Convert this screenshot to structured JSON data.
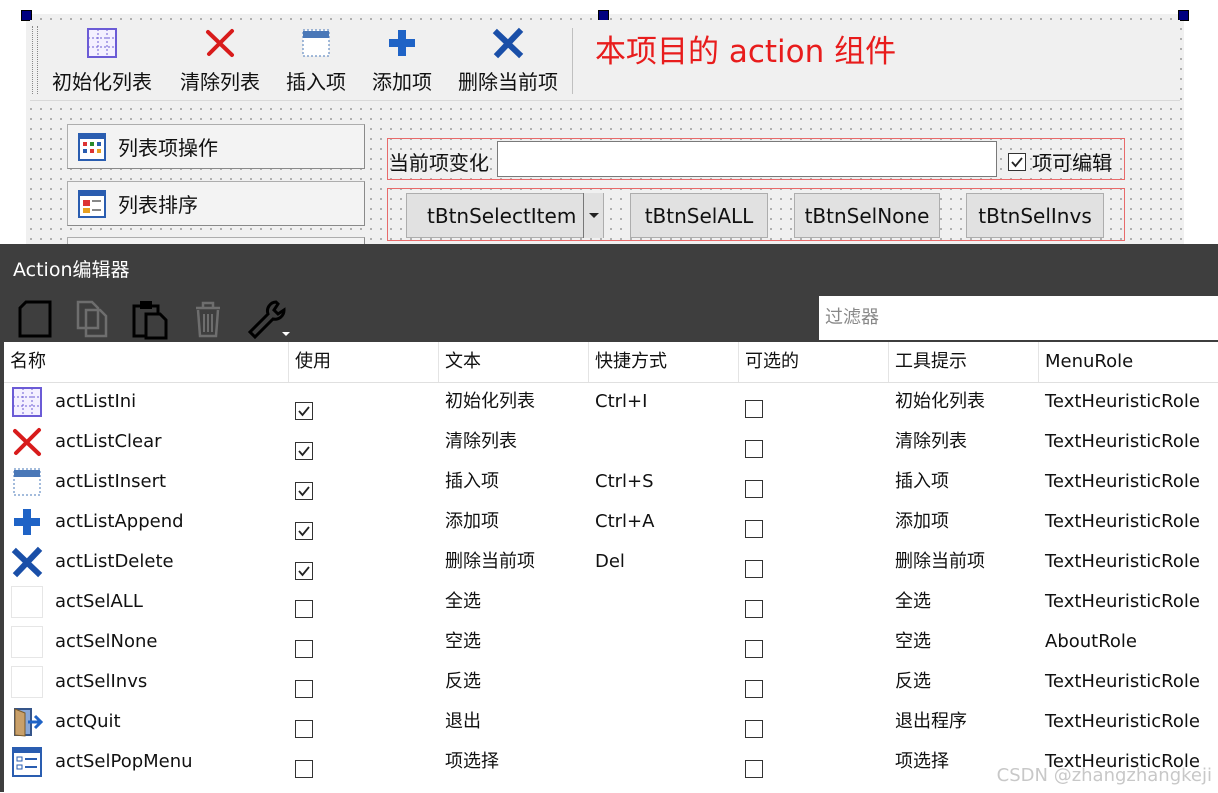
{
  "toolbar": {
    "buttons": [
      {
        "label": "初始化列表",
        "icon": "list-init-icon"
      },
      {
        "label": "清除列表",
        "icon": "red-x-icon"
      },
      {
        "label": "插入项",
        "icon": "insert-row-icon"
      },
      {
        "label": "添加项",
        "icon": "blue-plus-icon"
      },
      {
        "label": "删除当前项",
        "icon": "blue-x-icon"
      }
    ],
    "annotation": "本项目的 action 组件"
  },
  "side_buttons": [
    {
      "label": "列表项操作",
      "icon": "grid-icon"
    },
    {
      "label": "列表排序",
      "icon": "sort-icon"
    }
  ],
  "form": {
    "current_label": "当前项变化",
    "current_value": "",
    "editable_label": "项可编辑",
    "editable_checked": true,
    "buttons": [
      "tBtnSelectItem",
      "tBtnSelALL",
      "tBtnSelNone",
      "tBtnSelInvs"
    ]
  },
  "editor": {
    "title": "Action编辑器",
    "filter_placeholder": "过滤器",
    "columns": [
      "名称",
      "使用",
      "文本",
      "快捷方式",
      "可选的",
      "工具提示",
      "MenuRole"
    ],
    "rows": [
      {
        "name": "actListIni",
        "used": true,
        "text": "初始化列表",
        "shortcut": "Ctrl+I",
        "checkable": false,
        "tooltip": "初始化列表",
        "role": "TextHeuristicRole",
        "icon": "list-init-icon"
      },
      {
        "name": "actListClear",
        "used": true,
        "text": "清除列表",
        "shortcut": "",
        "checkable": false,
        "tooltip": "清除列表",
        "role": "TextHeuristicRole",
        "icon": "red-x-icon"
      },
      {
        "name": "actListInsert",
        "used": true,
        "text": "插入项",
        "shortcut": "Ctrl+S",
        "checkable": false,
        "tooltip": "插入项",
        "role": "TextHeuristicRole",
        "icon": "insert-row-icon"
      },
      {
        "name": "actListAppend",
        "used": true,
        "text": "添加项",
        "shortcut": "Ctrl+A",
        "checkable": false,
        "tooltip": "添加项",
        "role": "TextHeuristicRole",
        "icon": "blue-plus-icon"
      },
      {
        "name": "actListDelete",
        "used": true,
        "text": "删除当前项",
        "shortcut": "Del",
        "checkable": false,
        "tooltip": "删除当前项",
        "role": "TextHeuristicRole",
        "icon": "blue-x-icon"
      },
      {
        "name": "actSelALL",
        "used": false,
        "text": "全选",
        "shortcut": "",
        "checkable": false,
        "tooltip": "全选",
        "role": "TextHeuristicRole",
        "icon": "blank-icon"
      },
      {
        "name": "actSelNone",
        "used": false,
        "text": "空选",
        "shortcut": "",
        "checkable": false,
        "tooltip": "空选",
        "role": "AboutRole",
        "icon": "blank-icon"
      },
      {
        "name": "actSelInvs",
        "used": false,
        "text": "反选",
        "shortcut": "",
        "checkable": false,
        "tooltip": "反选",
        "role": "TextHeuristicRole",
        "icon": "blank-icon"
      },
      {
        "name": "actQuit",
        "used": false,
        "text": "退出",
        "shortcut": "",
        "checkable": false,
        "tooltip": "退出程序",
        "role": "TextHeuristicRole",
        "icon": "exit-door-icon"
      },
      {
        "name": "actSelPopMenu",
        "used": false,
        "text": "项选择",
        "shortcut": "",
        "checkable": false,
        "tooltip": "项选择",
        "role": "TextHeuristicRole",
        "icon": "list-select-icon"
      }
    ]
  },
  "watermark": "CSDN @zhangzhangkeji",
  "colors": {
    "annotation": "#e81c1c",
    "editor_bg": "#3e3e3e",
    "selection_handle": "#000080"
  }
}
